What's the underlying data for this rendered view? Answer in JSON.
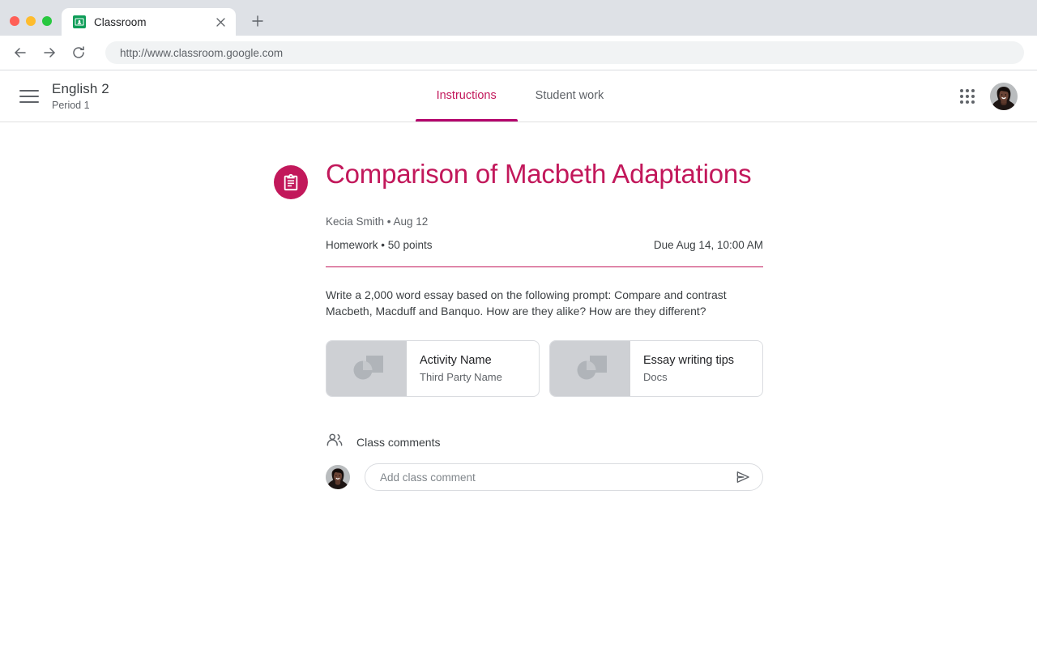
{
  "browser": {
    "tab": {
      "title": "Classroom",
      "favicon": "classroom-favicon",
      "close": "×"
    },
    "new_tab_label": "+",
    "back_label": "←",
    "forward_label": "→",
    "reload_label": "⟳",
    "url": "http://www.classroom.google.com"
  },
  "app_header": {
    "menu_icon": "hamburger-menu-icon",
    "course_name": "English 2",
    "course_section": "Period 1",
    "tabs": [
      {
        "label": "Instructions",
        "active": true
      },
      {
        "label": "Student work",
        "active": false
      }
    ],
    "apps_icon": "apps-grid-icon",
    "avatar": "user-avatar"
  },
  "assignment": {
    "icon": "assignment-clipboard-icon",
    "title": "Comparison of Macbeth Adaptations",
    "author": "Kecia Smith",
    "separator": "•",
    "posted_date": "Aug 12",
    "byline": "Kecia Smith  • Aug 12",
    "category": "Homework",
    "points": "50 points",
    "kind_line": "Homework • 50 points",
    "due": "Due Aug 14, 10:00 AM",
    "description": "Write a 2,000 word essay based on the following prompt: Compare and contrast Macbeth, Macduff and Banquo. How are they alike? How are they different?",
    "attachments": [
      {
        "name": "Activity Name",
        "subtitle": "Third Party Name",
        "thumbnail": "generic-image-placeholder-icon"
      },
      {
        "name": "Essay writing tips",
        "subtitle": "Docs",
        "thumbnail": "generic-image-placeholder-icon"
      }
    ]
  },
  "comments": {
    "icon": "people-icon",
    "heading": "Class comments",
    "avatar": "user-avatar",
    "input_value": "",
    "placeholder": "Add class comment",
    "send_icon": "send-icon"
  },
  "colors": {
    "accent_magenta": "#c2185b",
    "accent_underline": "#b3006b",
    "chrome_bg": "#dee1e6",
    "text_primary": "#3c4043",
    "text_secondary": "#5f6368",
    "favicon_green": "#0f9d58"
  }
}
